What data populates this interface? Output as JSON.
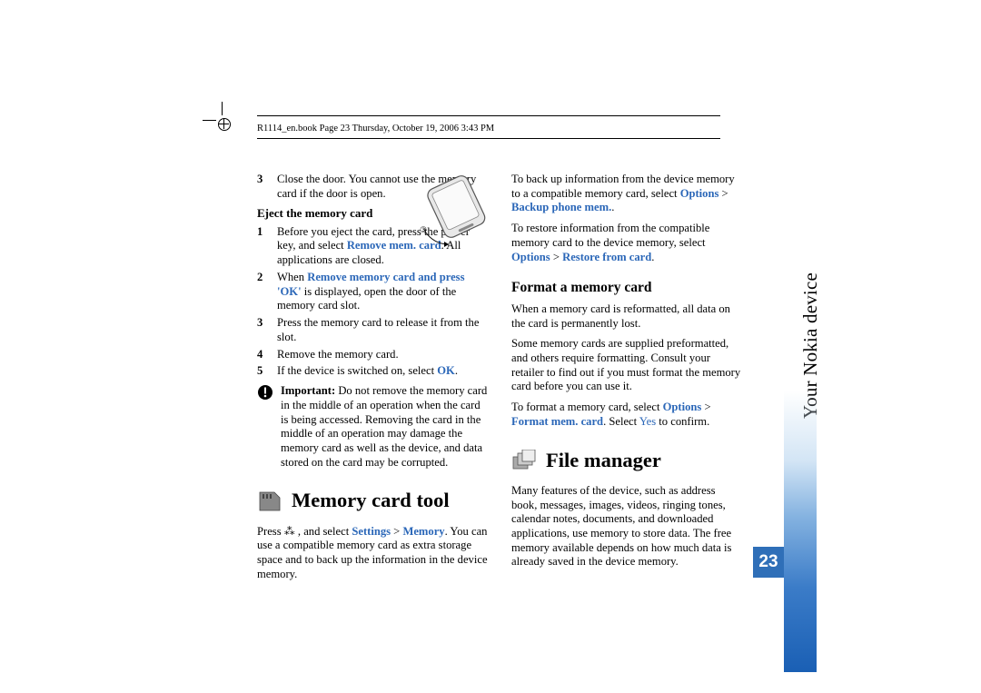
{
  "header": "R1114_en.book  Page 23  Thursday, October 19, 2006  3:43 PM",
  "side_label": "Your Nokia device",
  "page_number": "23",
  "left_col": {
    "step3": "Close the door. You cannot use the memory card if the door is open.",
    "eject_heading": "Eject the memory card",
    "e1a": "Before you eject the card, press the power key, and select ",
    "e1_link": "Remove mem. card",
    "e1b": ". All applications are closed.",
    "e2a": "When ",
    "e2_link": "Remove memory card and press 'OK'",
    "e2b": " is displayed, open the door of the memory card slot.",
    "e3": "Press the memory card to release it from the slot.",
    "e4": "Remove the memory card.",
    "e5a": "If the device is switched on, select ",
    "e5_link": "OK",
    "e5b": ".",
    "important_a": "Important: ",
    "important_b": "Do not remove the memory card in the middle of an operation when the card is being accessed. Removing the card in the middle of an operation may damage the memory card as well as the device, and data stored on the card may be corrupted.",
    "mct_heading": "Memory card tool",
    "mct_p1a": "Press ",
    "mct_p1b": " , and select ",
    "mct_link1": "Settings",
    "mct_gt": " > ",
    "mct_link2": "Memory",
    "mct_p1c": ". You can use a compatible memory card as extra storage space and to back up the information in the device memory."
  },
  "right_col": {
    "p1a": "To back up information from the device memory to a compatible memory card, select ",
    "p1_opt": "Options",
    "gt": " > ",
    "p1_link": "Backup phone mem.",
    "p2a": "To restore information from the compatible memory card to the device memory, select ",
    "p2_link": "Restore from card",
    "fmt_heading": "Format a memory card",
    "fmt_p1": "When a memory card is reformatted, all data on the card is permanently lost.",
    "fmt_p2": "Some memory cards are supplied preformatted, and others require formatting. Consult your retailer to find out if you must format the memory card before you can use it.",
    "fmt_p3a": "To format a memory card, select ",
    "fmt_p3_link": "Format mem. card",
    "fmt_p3b": ". Select ",
    "fmt_p3_yes": "Yes",
    "fmt_p3c": " to confirm.",
    "fm_heading": "File manager",
    "fm_p1": "Many features of the device, such as address book, messages, images, videos, ringing tones, calendar notes, documents, and downloaded applications, use memory to store data. The free memory available depends on how much data is already saved in the device memory."
  }
}
